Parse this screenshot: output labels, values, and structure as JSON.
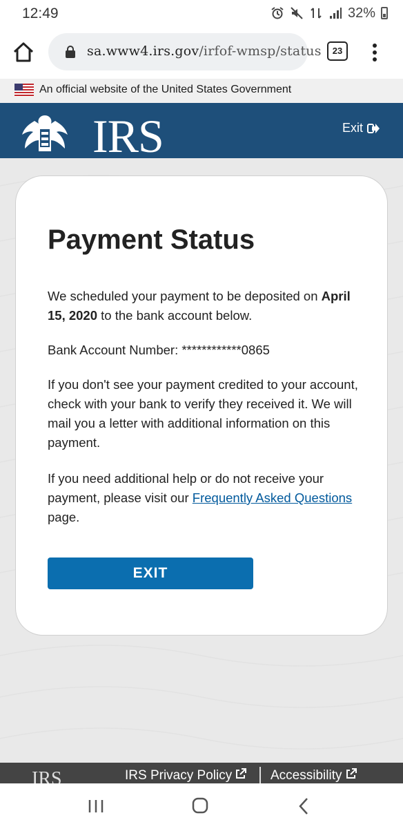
{
  "status_bar": {
    "time": "12:49",
    "battery": "32%"
  },
  "browser": {
    "url_host": "sa.www4.irs.gov",
    "url_path": "/irfof-wmsp/status",
    "tab_count": "23"
  },
  "gov_banner": {
    "text": "An official website of the United States Government"
  },
  "header": {
    "logo_text": "IRS",
    "exit_label": "Exit"
  },
  "card": {
    "title": "Payment Status",
    "p1_pre": "We scheduled your payment to be deposited on ",
    "p1_date": "April 15, 2020",
    "p1_post": " to the bank account below.",
    "account_line": "Bank Account Number: ************0865",
    "p3": "If you don't see your payment credited to your account, check with your bank to verify they received it. We will mail you a letter with additional information on this payment.",
    "p4_pre": "If you need additional help or do not receive your payment, please visit our ",
    "p4_link": "Frequently Asked Questions",
    "p4_post": " page.",
    "exit_button": "EXIT"
  },
  "footer": {
    "logo_text": "IRS",
    "privacy_link": "IRS Privacy Policy",
    "accessibility_link": "Accessibility"
  },
  "colors": {
    "irs_blue": "#1e4f7a",
    "button_blue": "#0b6eaf",
    "link_blue": "#00599c"
  }
}
